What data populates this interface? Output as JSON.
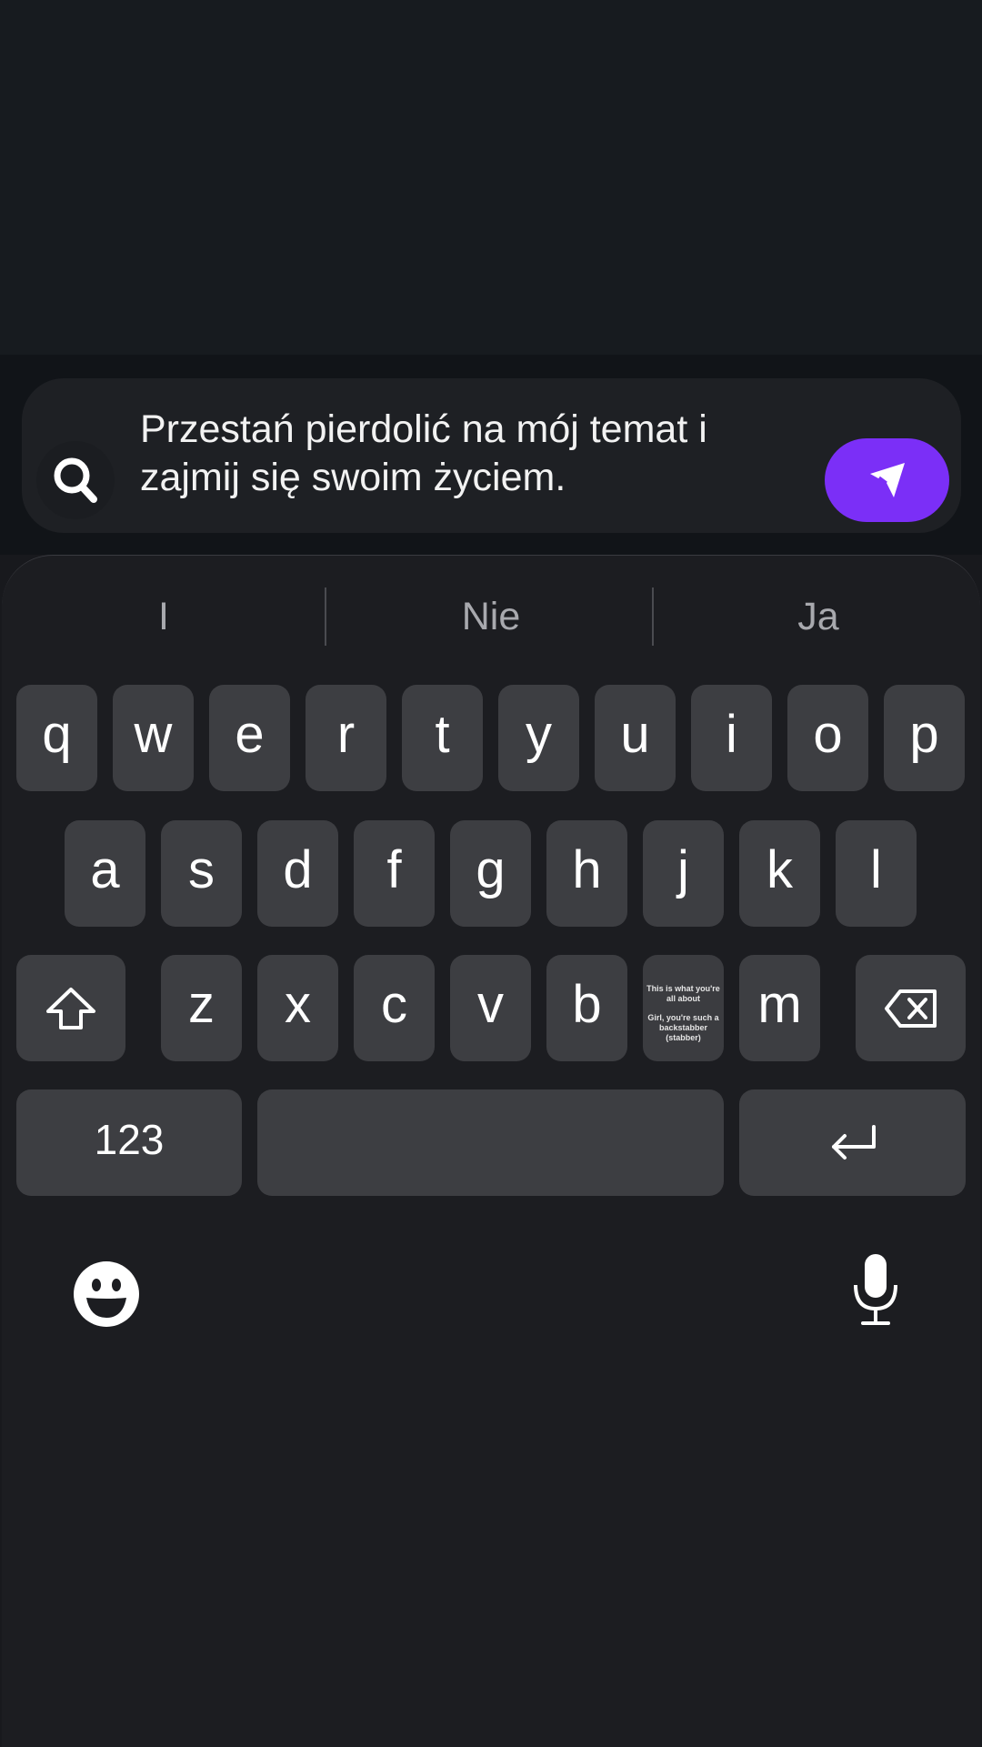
{
  "composer": {
    "message": "Przestań pierdolić na mój temat i zajmij się swoim życiem.",
    "search_icon": "search-icon",
    "send_icon": "send-icon",
    "send_color": "#7b2ff7"
  },
  "keyboard": {
    "suggestions": [
      "I",
      "Nie",
      "Ja"
    ],
    "row1": [
      "q",
      "w",
      "e",
      "r",
      "t",
      "y",
      "u",
      "i",
      "o",
      "p"
    ],
    "row2": [
      "a",
      "s",
      "d",
      "f",
      "g",
      "h",
      "j",
      "k",
      "l"
    ],
    "row3_left": [
      "z",
      "x",
      "c",
      "v",
      "b"
    ],
    "row3_right": [
      "m"
    ],
    "preview_key": {
      "line1": "This is what you're all about",
      "line2": "Girl, you're such a backstabber (stabber)"
    },
    "numbers_label": "123",
    "shift_icon": "shift-icon",
    "backspace_icon": "backspace-icon",
    "return_icon": "return-icon",
    "emoji_icon": "emoji-icon",
    "mic_icon": "microphone-icon"
  }
}
